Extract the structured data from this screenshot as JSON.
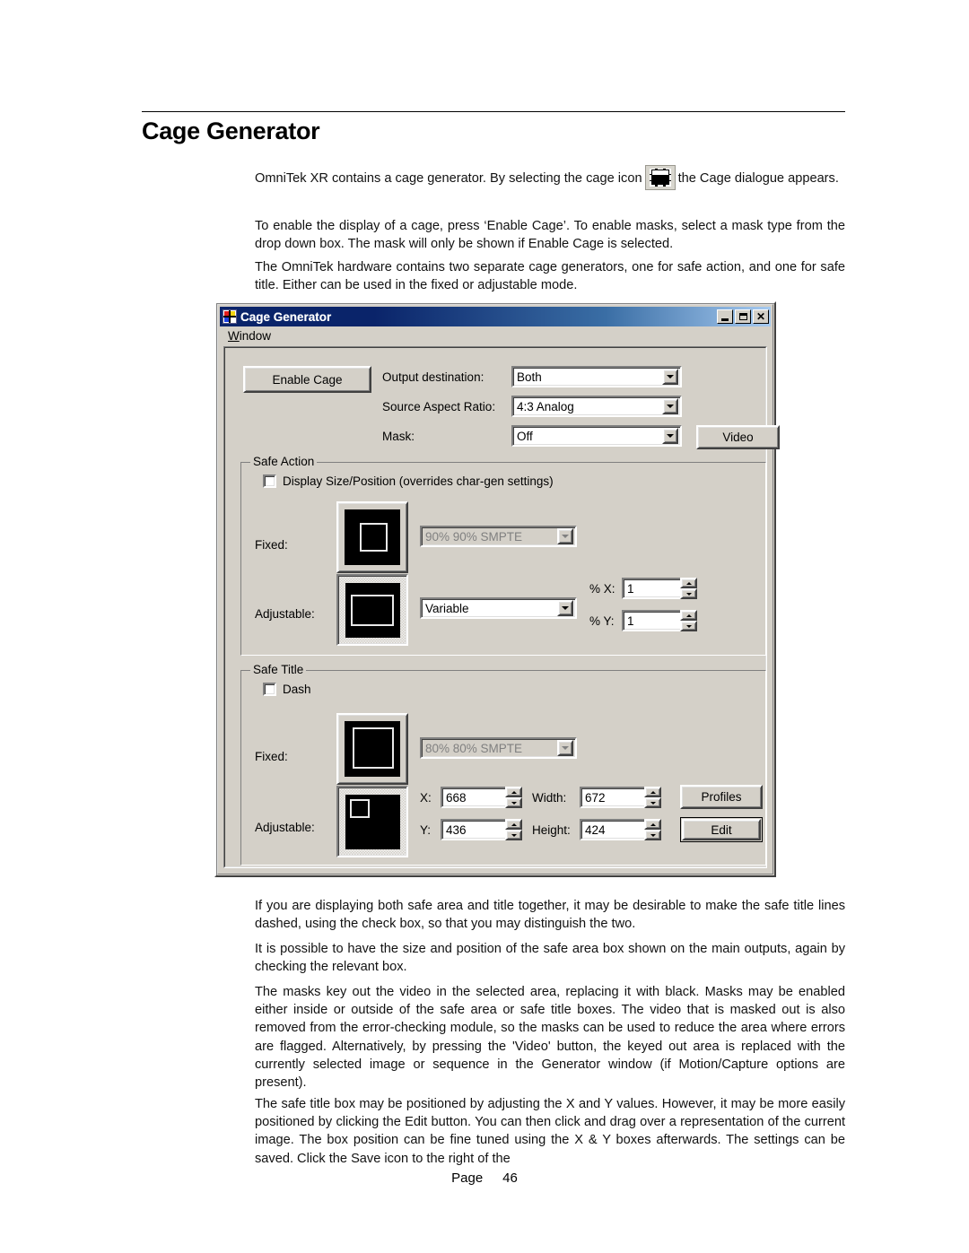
{
  "document": {
    "heading": "Cage Generator",
    "paragraphs": [
      {
        "id": "p1a",
        "text_before_icon": "OmniTek XR contains a cage generator. By selecting the cage icon",
        "icon": "cage-icon",
        "text_after_icon": "the Cage dialogue appears."
      },
      {
        "id": "p2",
        "text": "To enable the display of a cage, press ‘Enable Cage’. To enable masks, select a mask type from the drop down box. The mask will only be shown if Enable Cage is selected."
      },
      {
        "id": "p3",
        "text": "The OmniTek hardware contains two separate cage generators, one for safe action, and one for safe title. Either can be used in the fixed or adjustable mode."
      },
      {
        "id": "p4",
        "text": "If you are displaying both safe area and title together, it may be desirable to make the safe title lines dashed, using the check box, so that you may distinguish the two."
      },
      {
        "id": "p5",
        "text": "It is possible to have the size and position of the safe area box shown on the main outputs, again by checking the relevant box."
      },
      {
        "id": "p6",
        "text": "The masks key out the video in the selected area, replacing it with black. Masks may be enabled either inside or outside of the safe area or safe title boxes. The video that is masked out is also removed from the error-checking module, so the masks can be used to reduce the area where errors are flagged. Alternatively, by pressing the 'Video' button, the keyed out area is replaced with the currently selected image or sequence in the Generator window (if Motion/Capture options are present)."
      },
      {
        "id": "p7",
        "text": "The safe title box may be positioned by adjusting the X and Y values. However, it may be more easily positioned by clicking the Edit button. You can then click and drag over a representation of the current image. The box position can be fine tuned using the X & Y boxes afterwards. The settings can be saved. Click the Save icon to the right of the"
      }
    ],
    "footer": {
      "page_label": "Page",
      "page_number": "46"
    }
  },
  "dialog": {
    "title": "Cage Generator",
    "titlebar_icon": "mondrian-grid-icon",
    "window_buttons": {
      "minimize": "minimize-icon",
      "maximize": "maximize-icon",
      "close": "✕"
    },
    "menu": [
      {
        "label": "Window",
        "accel": "W"
      }
    ],
    "top": {
      "enable_cage_button": "Enable Cage",
      "rows": [
        {
          "label": "Output destination:",
          "value": "Both",
          "disabled": false
        },
        {
          "label": "Source Aspect Ratio:",
          "value": "4:3 Analog",
          "disabled": false
        },
        {
          "label": "Mask:",
          "value": "Off",
          "disabled": false
        }
      ],
      "video_button": "Video"
    },
    "safe_action": {
      "group_title": "Safe Action",
      "checkbox": {
        "label": "Display Size/Position (overrides char-gen settings)",
        "checked": false
      },
      "fixed_label": "Fixed:",
      "fixed_combo_value": "90% 90% SMPTE",
      "fixed_combo_disabled": true,
      "adjustable_label": "Adjustable:",
      "adjustable_combo_value": "Variable",
      "selected_mode": "adjustable",
      "percent_x_label": "% X:",
      "percent_x_value": "1",
      "percent_y_label": "% Y:",
      "percent_y_value": "1"
    },
    "safe_title": {
      "group_title": "Safe Title",
      "checkbox": {
        "label": "Dash",
        "checked": false
      },
      "fixed_label": "Fixed:",
      "fixed_combo_value": "80% 80% SMPTE",
      "fixed_combo_disabled": true,
      "adjustable_label": "Adjustable:",
      "selected_mode": "adjustable",
      "fields": [
        {
          "label": "X:",
          "value": "668"
        },
        {
          "label": "Y:",
          "value": "436"
        },
        {
          "label": "Width:",
          "value": "672"
        },
        {
          "label": "Height:",
          "value": "424"
        }
      ],
      "profiles_button": "Profiles",
      "edit_button": "Edit"
    }
  },
  "colors": {
    "dialog_face": "#d4d0c8",
    "titlebar_start": "#0a246a",
    "titlebar_end": "#a6caf0",
    "page_background": "#ffffff"
  }
}
